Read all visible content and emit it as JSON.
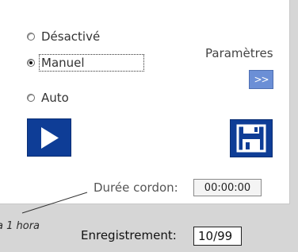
{
  "mode_options": [
    {
      "label": "Désactivé",
      "selected": false
    },
    {
      "label": "Manuel",
      "selected": true
    },
    {
      "label": "Auto",
      "selected": false
    }
  ],
  "parameters": {
    "label": "Paramètres",
    "button_label": ">>"
  },
  "play_button": {
    "icon": "play-icon"
  },
  "save_button": {
    "icon": "floppy-disk-icon"
  },
  "duration": {
    "label": "Durée cordon:",
    "value": "00:00:00"
  },
  "note": "a 1 hora",
  "record": {
    "label": "Enregistrement:",
    "value": "10/99"
  },
  "colors": {
    "accent": "#0e3d96",
    "params_button": "#6b8fd6",
    "panel": "#ffffff",
    "background": "#d6d6d6"
  }
}
